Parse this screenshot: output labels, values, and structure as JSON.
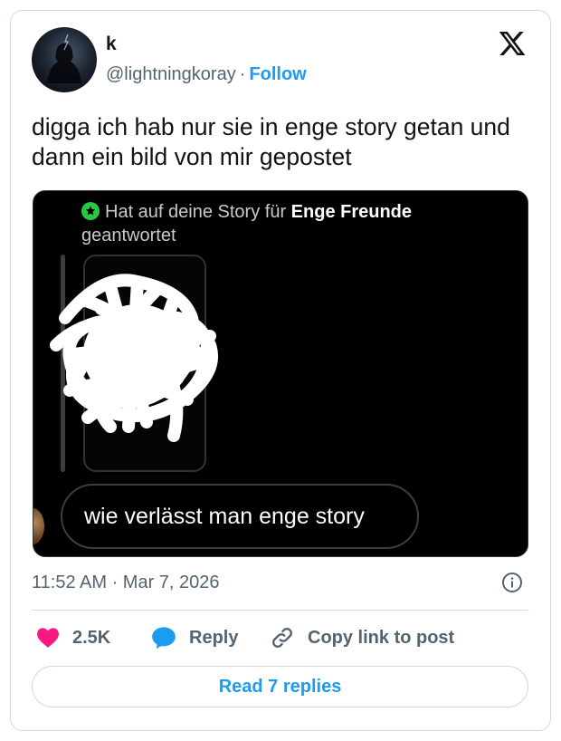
{
  "author": {
    "display_name": "k",
    "handle": "@lightningkoray",
    "separator": "·",
    "follow_label": "Follow"
  },
  "tweet": {
    "text": "digga ich hab nur sie in enge story getan und dann ein bild von mir gepostet",
    "timestamp": "11:52 AM · Mar 7, 2026"
  },
  "media": {
    "reply_prefix": "Hat auf deine Story für ",
    "reply_bold": "Enge Freunde",
    "reply_suffix": " geantwortet",
    "message": "wie verlässt man enge story"
  },
  "actions": {
    "likes_count": "2.5K",
    "reply_label": "Reply",
    "copy_label": "Copy link to post"
  },
  "read_replies_label": "Read 7 replies",
  "icons": {
    "logo": "x-logo-icon",
    "like": "heart-icon",
    "reply": "speech-bubble-icon",
    "copy": "link-icon",
    "info": "info-icon",
    "story_badge": "star-icon"
  },
  "colors": {
    "accent": "#1d9bf0",
    "like": "#f91880",
    "muted": "#536471",
    "close_friends": "#28c940"
  }
}
